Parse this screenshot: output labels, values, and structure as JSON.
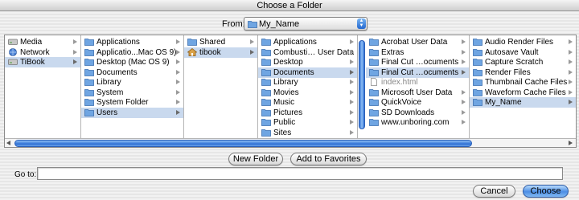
{
  "window": {
    "title": "Choose a Folder"
  },
  "from": {
    "label": "From:",
    "value": "My_Name"
  },
  "columns": [
    {
      "items": [
        {
          "label": "Media",
          "icon": "drive-icon",
          "selected": false,
          "chevron": true
        },
        {
          "label": "Network",
          "icon": "globe-icon",
          "selected": false,
          "chevron": true
        },
        {
          "label": "TiBook",
          "icon": "drive-icon",
          "selected": true,
          "chevron": true
        }
      ]
    },
    {
      "items": [
        {
          "label": "Applications",
          "icon": "folder-icon",
          "selected": false,
          "chevron": true
        },
        {
          "label": "Applicatio...Mac OS 9)",
          "icon": "folder-icon",
          "selected": false,
          "chevron": true
        },
        {
          "label": "Desktop (Mac OS 9)",
          "icon": "folder-icon",
          "selected": false,
          "chevron": true
        },
        {
          "label": "Documents",
          "icon": "folder-icon",
          "selected": false,
          "chevron": true
        },
        {
          "label": "Library",
          "icon": "folder-icon",
          "selected": false,
          "chevron": true
        },
        {
          "label": "System",
          "icon": "folder-icon",
          "selected": false,
          "chevron": true
        },
        {
          "label": "System Folder",
          "icon": "folder-icon",
          "selected": false,
          "chevron": true
        },
        {
          "label": "Users",
          "icon": "folder-icon",
          "selected": true,
          "chevron": true
        }
      ]
    },
    {
      "items": [
        {
          "label": "Shared",
          "icon": "folder-icon",
          "selected": false,
          "chevron": true
        },
        {
          "label": "tibook",
          "icon": "home-icon",
          "selected": true,
          "chevron": true
        }
      ]
    },
    {
      "items": [
        {
          "label": "Applications",
          "icon": "folder-icon",
          "selected": false,
          "chevron": true
        },
        {
          "label": "Combusti… User Data",
          "icon": "folder-icon",
          "selected": false,
          "chevron": true
        },
        {
          "label": "Desktop",
          "icon": "folder-icon",
          "selected": false,
          "chevron": true
        },
        {
          "label": "Documents",
          "icon": "folder-icon",
          "selected": true,
          "chevron": true
        },
        {
          "label": "Library",
          "icon": "folder-icon",
          "selected": false,
          "chevron": true
        },
        {
          "label": "Movies",
          "icon": "folder-icon",
          "selected": false,
          "chevron": true
        },
        {
          "label": "Music",
          "icon": "folder-icon",
          "selected": false,
          "chevron": true
        },
        {
          "label": "Pictures",
          "icon": "folder-icon",
          "selected": false,
          "chevron": true
        },
        {
          "label": "Public",
          "icon": "folder-icon",
          "selected": false,
          "chevron": true
        },
        {
          "label": "Sites",
          "icon": "folder-icon",
          "selected": false,
          "chevron": true
        }
      ]
    },
    {
      "items": [
        {
          "label": "Acrobat User Data",
          "icon": "folder-icon",
          "selected": false,
          "chevron": true
        },
        {
          "label": "Extras",
          "icon": "folder-icon",
          "selected": false,
          "chevron": true
        },
        {
          "label": "Final Cut …ocuments",
          "icon": "folder-icon",
          "selected": false,
          "chevron": true
        },
        {
          "label": "Final Cut …ocuments",
          "icon": "folder-icon",
          "selected": true,
          "chevron": true
        },
        {
          "label": "index.html",
          "icon": "document-icon",
          "selected": false,
          "chevron": false,
          "gray": true
        },
        {
          "label": "Microsoft User Data",
          "icon": "folder-icon",
          "selected": false,
          "chevron": true
        },
        {
          "label": "QuickVoice",
          "icon": "folder-icon",
          "selected": false,
          "chevron": true
        },
        {
          "label": "SD Downloads",
          "icon": "folder-icon",
          "selected": false,
          "chevron": true
        },
        {
          "label": "www.unboring.com",
          "icon": "folder-icon",
          "selected": false,
          "chevron": true
        }
      ]
    },
    {
      "items": [
        {
          "label": "Audio Render Files",
          "icon": "folder-icon",
          "selected": false,
          "chevron": true
        },
        {
          "label": "Autosave Vault",
          "icon": "folder-icon",
          "selected": false,
          "chevron": true
        },
        {
          "label": "Capture Scratch",
          "icon": "folder-icon",
          "selected": false,
          "chevron": true
        },
        {
          "label": "Render Files",
          "icon": "folder-icon",
          "selected": false,
          "chevron": true
        },
        {
          "label": "Thumbnail Cache Files",
          "icon": "folder-icon",
          "selected": false,
          "chevron": true
        },
        {
          "label": "Waveform Cache Files",
          "icon": "folder-icon",
          "selected": false,
          "chevron": true
        },
        {
          "label": "My_Name",
          "icon": "folder-icon",
          "selected": true,
          "chevron": true
        }
      ]
    }
  ],
  "buttons": {
    "new_folder": "New Folder",
    "add_favorites": "Add to Favorites",
    "cancel": "Cancel",
    "choose": "Choose"
  },
  "goto": {
    "label": "Go to:",
    "value": ""
  },
  "colors": {
    "selection": "#c9d9ee",
    "scroll_blue": "#2f6fd4",
    "folder_blue": "#6fa5e2"
  }
}
